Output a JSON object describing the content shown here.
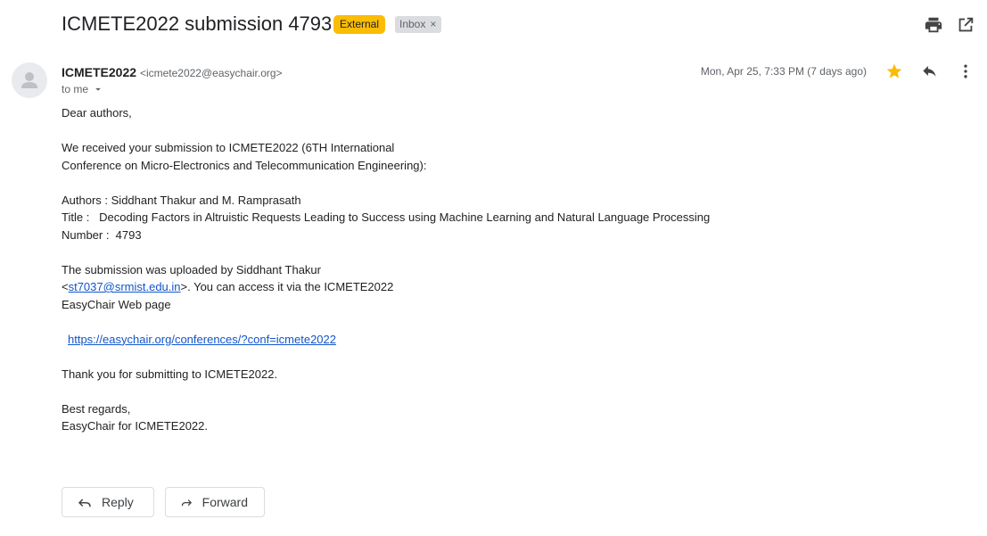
{
  "header": {
    "subject": "ICMETE2022 submission 4793",
    "labels": {
      "external": "External",
      "inbox": "Inbox",
      "remove": "×"
    },
    "icons": [
      "print-icon",
      "open-in-new-window-icon"
    ]
  },
  "message": {
    "sender_name": "ICMETE2022",
    "sender_email": "<icmete2022@easychair.org>",
    "to_me": "to me",
    "date": "Mon, Apr 25, 7:33 PM (7 days ago)",
    "starred": true,
    "colors": {
      "star": "#fbbc04",
      "external_label": "#fbbc04",
      "link": "#1155cc"
    }
  },
  "body": {
    "greeting": "Dear authors,",
    "received_line1": "We received your submission to ICMETE2022 (6TH International",
    "received_line2": "Conference on Micro-Electronics and Telecommunication Engineering):",
    "authors": "Authors : Siddhant Thakur and M. Ramprasath",
    "title": "Title :   Decoding Factors in Altruistic Requests Leading to Success using Machine Learning and Natural Language Processing",
    "number": "Number :  4793",
    "uploaded_line1": "The submission was uploaded by Siddhant Thakur",
    "uploaded_prefix": "<",
    "uploader_email": "st7037@srmist.edu.in",
    "uploaded_suffix": ">. You can access it via the ICMETE2022",
    "uploaded_line3": "EasyChair Web page",
    "conference_link": "https://easychair.org/conferences/?conf=icmete2022",
    "thanks": "Thank you for submitting to ICMETE2022.",
    "regards1": "Best regards,",
    "regards2": "EasyChair for ICMETE2022."
  },
  "actions": {
    "reply": "Reply",
    "forward": "Forward"
  }
}
